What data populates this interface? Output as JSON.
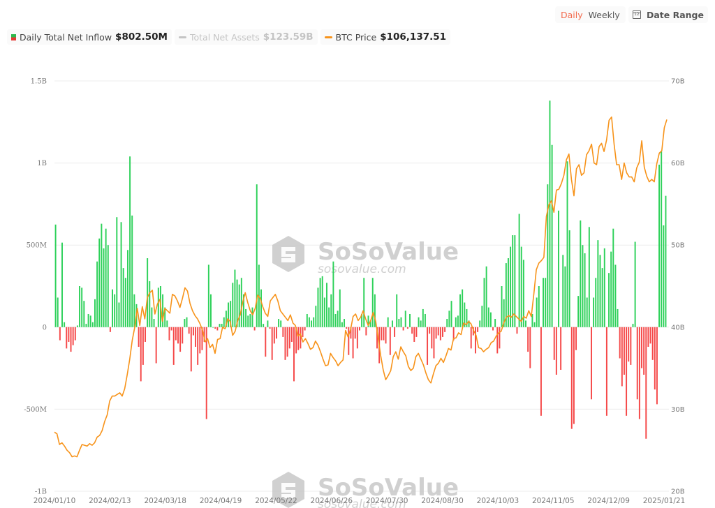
{
  "toolbar": {
    "period_options": [
      "Daily",
      "Weekly"
    ],
    "active_period": "Daily",
    "date_range_label": "Date Range",
    "calendar_icon_text": "12"
  },
  "legend": {
    "items": [
      {
        "label": "Daily Total Net Inflow",
        "value": "$802.50M",
        "icon": "bar-swatch",
        "colors": [
          "#2db84d",
          "#e53935"
        ],
        "active": true
      },
      {
        "label": "Total Net Assets",
        "value": "$123.59B",
        "icon": "line-swatch",
        "color": "#c4c4c4",
        "active": false
      },
      {
        "label": "BTC Price",
        "value": "$106,137.51",
        "icon": "line-swatch",
        "color": "#f7931a",
        "active": true
      }
    ]
  },
  "watermark": {
    "brand": "SoSoValue",
    "site": "sosovalue.com"
  },
  "colors": {
    "positive": "#2ed15a",
    "negative": "#f54848",
    "line": "#f7931a",
    "grid": "#ececec"
  },
  "chart_data": {
    "type": "bar",
    "title": "",
    "xlabel": "",
    "ylabel": "",
    "left_axis": {
      "ticks": [
        "1.5B",
        "1B",
        "500M",
        "0",
        "-500M",
        "-1B"
      ],
      "values": [
        1500,
        1000,
        500,
        0,
        -500,
        -1000
      ],
      "ylim": [
        -1000,
        1500
      ],
      "unit": "M USD"
    },
    "right_axis": {
      "ticks": [
        "70B",
        "60B",
        "50B",
        "40B",
        "30B",
        "20B"
      ],
      "values": [
        70,
        60,
        50,
        40,
        30,
        20
      ],
      "ylim": [
        20,
        70
      ],
      "unit": "B"
    },
    "x_tick_labels": [
      "2024/01/10",
      "2024/02/13",
      "2024/03/18",
      "2024/04/19",
      "2024/05/22",
      "2024/06/26",
      "2024/07/30",
      "2024/08/30",
      "2024/10/03",
      "2024/11/05",
      "2024/12/09",
      "2025/01/21"
    ],
    "grid": true,
    "legend_position": "top-left",
    "series": [
      {
        "name": "Daily Total Net Inflow",
        "type": "bar",
        "axis": "left",
        "values": [
          625,
          180,
          -80,
          515,
          30,
          -130,
          -90,
          -150,
          -110,
          -80,
          10,
          250,
          240,
          160,
          20,
          80,
          70,
          30,
          170,
          400,
          540,
          630,
          480,
          600,
          500,
          -30,
          230,
          200,
          670,
          150,
          640,
          360,
          300,
          470,
          1040,
          680,
          200,
          140,
          -120,
          -330,
          -230,
          -90,
          420,
          280,
          120,
          50,
          -220,
          240,
          250,
          200,
          120,
          40,
          -80,
          -20,
          -230,
          -80,
          -100,
          -150,
          -100,
          50,
          60,
          -40,
          -270,
          -50,
          -120,
          -230,
          -160,
          -140,
          -90,
          -560,
          380,
          200,
          0,
          -10,
          -20,
          20,
          20,
          60,
          100,
          150,
          160,
          270,
          350,
          290,
          260,
          300,
          200,
          110,
          70,
          80,
          120,
          -20,
          870,
          380,
          230,
          20,
          -180,
          40,
          -10,
          -200,
          -100,
          -70,
          50,
          40,
          -60,
          -200,
          -180,
          -130,
          -90,
          -330,
          -160,
          -140,
          -130,
          -60,
          -20,
          80,
          60,
          40,
          60,
          130,
          240,
          300,
          310,
          180,
          270,
          120,
          200,
          400,
          80,
          100,
          230,
          30,
          50,
          -10,
          -170,
          -70,
          -190,
          -70,
          -130,
          -20,
          80,
          300,
          -50,
          70,
          40,
          300,
          200,
          -130,
          -220,
          -80,
          -80,
          -100,
          60,
          -170,
          40,
          -60,
          200,
          50,
          60,
          -20,
          100,
          -10,
          80,
          -40,
          -90,
          -60,
          60,
          40,
          110,
          80,
          -230,
          -40,
          -130,
          -190,
          -70,
          -50,
          -80,
          -60,
          -30,
          50,
          100,
          160,
          -80,
          60,
          70,
          200,
          230,
          150,
          110,
          40,
          -130,
          -50,
          -160,
          -30,
          40,
          130,
          300,
          370,
          120,
          90,
          -20,
          50,
          -160,
          -130,
          250,
          170,
          390,
          420,
          490,
          560,
          560,
          -40,
          690,
          490,
          410,
          40,
          -150,
          -250,
          80,
          30,
          180,
          250,
          -540,
          300,
          300,
          870,
          1380,
          1110,
          -200,
          -290,
          710,
          -260,
          440,
          370,
          1010,
          590,
          -620,
          -590,
          -140,
          190,
          650,
          500,
          450,
          180,
          610,
          -440,
          180,
          300,
          530,
          440,
          360,
          480,
          -540,
          330,
          460,
          600,
          380,
          110,
          -190,
          -360,
          -290,
          -540,
          -210,
          -230,
          20,
          520,
          -440,
          -560,
          -250,
          -290,
          -680,
          -120,
          -100,
          -200,
          -380,
          -470,
          990,
          1070,
          620,
          800
        ]
      },
      {
        "name": "BTC Price (right-axis scale)",
        "type": "line",
        "axis": "right",
        "values": [
          27.2,
          27.0,
          25.7,
          25.9,
          25.5,
          25.0,
          24.7,
          24.2,
          24.3,
          24.2,
          25.0,
          25.7,
          25.6,
          25.5,
          25.8,
          25.6,
          25.9,
          26.6,
          26.8,
          27.4,
          28.5,
          29.3,
          31.0,
          31.6,
          31.6,
          31.8,
          32.0,
          31.6,
          32.5,
          34.2,
          36.1,
          38.4,
          40.0,
          42.3,
          40.2,
          42.5,
          41.0,
          43.6,
          44.2,
          44.5,
          41.6,
          42.8,
          43.4,
          40.7,
          42.3,
          42.0,
          41.7,
          44.0,
          43.8,
          43.2,
          42.4,
          43.5,
          44.8,
          44.4,
          42.9,
          42.0,
          41.4,
          41.0,
          40.4,
          39.6,
          38.2,
          38.6,
          37.5,
          37.9,
          36.8,
          38.5,
          38.6,
          40.0,
          39.8,
          41.0,
          40.7,
          39.0,
          39.5,
          40.8,
          41.5,
          43.0,
          44.2,
          43.0,
          42.0,
          41.5,
          42.3,
          43.9,
          43.5,
          42.5,
          41.7,
          41.3,
          43.2,
          43.6,
          44.0,
          43.2,
          42.0,
          41.6,
          41.2,
          40.8,
          41.5,
          40.5,
          40.2,
          38.9,
          39.2,
          38.2,
          38.6,
          38.0,
          37.3,
          37.5,
          38.3,
          37.8,
          37.0,
          36.1,
          35.3,
          35.4,
          36.8,
          36.3,
          35.9,
          35.3,
          35.7,
          36.0,
          39.6,
          38.8,
          39.7,
          41.3,
          41.6,
          40.8,
          41.2,
          42.0,
          41.0,
          40.2,
          40.8,
          41.8,
          40.7,
          38.6,
          36.5,
          34.8,
          33.6,
          34.1,
          34.7,
          36.4,
          37.0,
          36.1,
          37.6,
          37.0,
          36.5,
          35.2,
          34.7,
          35.0,
          36.4,
          36.8,
          36.1,
          35.4,
          34.4,
          33.6,
          33.2,
          34.3,
          35.3,
          35.6,
          36.2,
          35.7,
          36.5,
          37.4,
          37.2,
          38.6,
          38.7,
          39.3,
          39.1,
          40.5,
          40.3,
          40.7,
          40.4,
          39.6,
          39.0,
          37.5,
          37.4,
          37.0,
          37.3,
          37.5,
          38.1,
          38.3,
          38.9,
          39.3,
          39.5,
          40.5,
          41.2,
          41.4,
          41.2,
          41.6,
          41.3,
          41.0,
          40.7,
          41.3,
          41.1,
          42.0,
          41.3,
          44.0,
          47.0,
          47.8,
          48.1,
          48.5,
          53.5,
          54.9,
          55.4,
          54.0,
          56.7,
          56.8,
          57.5,
          58.5,
          60.4,
          61.1,
          58.0,
          56.0,
          59.3,
          59.8,
          58.5,
          58.8,
          61.0,
          61.5,
          62.3,
          60.0,
          59.8,
          62.0,
          62.4,
          61.4,
          62.8,
          65.2,
          65.6,
          62.3,
          59.8,
          59.8,
          58.0,
          60.0,
          58.8,
          58.3,
          58.3,
          57.7,
          59.4,
          60.1,
          62.7,
          59.5,
          58.4,
          57.7,
          58.0,
          57.7,
          59.9,
          61.2,
          61.5,
          64.3,
          65.3
        ]
      }
    ]
  }
}
